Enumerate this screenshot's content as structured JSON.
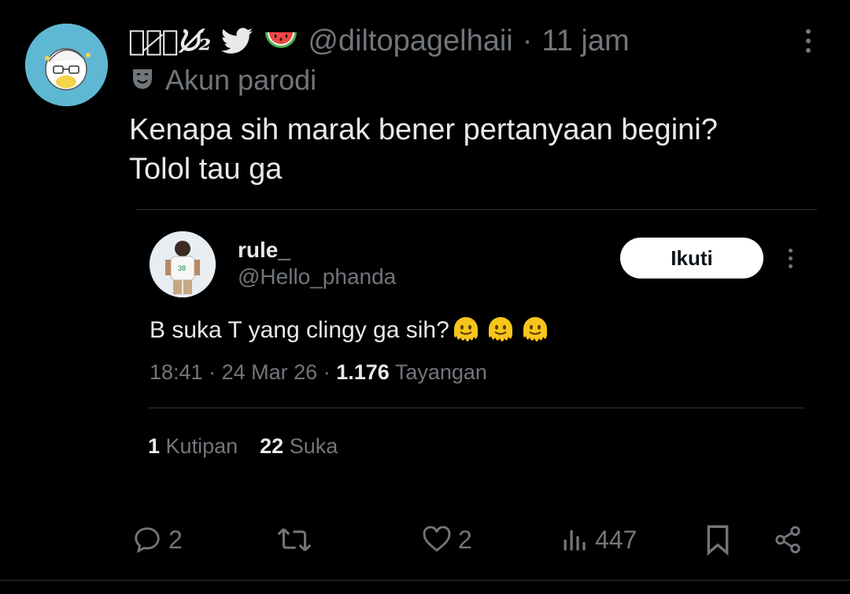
{
  "author": {
    "display_name": "ﾉﾞ̷ℕᙀ̸₂",
    "handle": "@diltopagelhaii",
    "separator": "·",
    "time": "11 jam",
    "parody_label": "Akun parodi",
    "name_icons": [
      "twitter-bird-icon",
      "watermelon-icon"
    ],
    "avatar_color": "#5fb8d3"
  },
  "tweet": {
    "lines": [
      "Kenapa sih marak bener pertanyaan begini?",
      "Tolol tau ga"
    ]
  },
  "quote": {
    "name": "rule_",
    "handle": "@Hello_phanda",
    "follow_label": "Ikuti",
    "text": "B suka T yang clingy ga sih?",
    "emojis": [
      "melting-face-icon",
      "melting-face-icon",
      "melting-face-icon"
    ],
    "time": "18:41",
    "date": "24 Mar 26",
    "meta_sep": "·",
    "views_count": "1.176",
    "views_label": "Tayangan",
    "quotes_count": "1",
    "quotes_label": "Kutipan",
    "likes_count": "22",
    "likes_label": "Suka"
  },
  "actions": {
    "replies": "2",
    "likes": "2",
    "views": "447"
  },
  "colors": {
    "background": "#000000",
    "text": "#e7e9ea",
    "muted": "#71767b",
    "divider": "#2f3336",
    "follow_bg": "#ffffff"
  }
}
